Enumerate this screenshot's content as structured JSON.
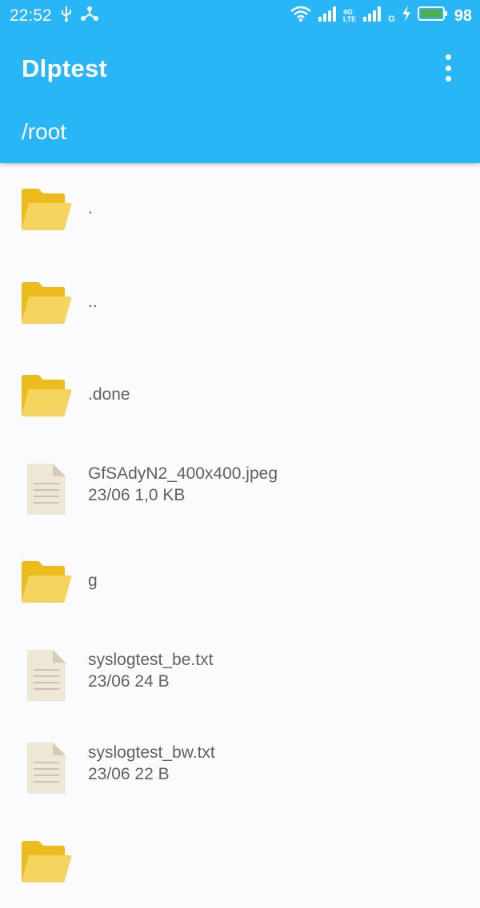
{
  "status_bar": {
    "time": "22:52",
    "network_label": "4G",
    "network_sub": "LTE",
    "g_label": "G",
    "battery": "98",
    "battery_color": "#4caf50"
  },
  "app_bar": {
    "title": "Dlptest",
    "menu_icon": "more-vert-icon"
  },
  "path": "/root",
  "colors": {
    "primary": "#29b6f6",
    "folder": "#f0c419",
    "file": "#efe9d8",
    "text": "#616161"
  },
  "items": [
    {
      "type": "folder",
      "name": ".",
      "meta": ""
    },
    {
      "type": "folder",
      "name": "..",
      "meta": ""
    },
    {
      "type": "folder",
      "name": ".done",
      "meta": ""
    },
    {
      "type": "file",
      "name": "GfSAdyN2_400x400.jpeg",
      "meta": "23/06 1,0 KB"
    },
    {
      "type": "folder",
      "name": "g",
      "meta": ""
    },
    {
      "type": "file",
      "name": "syslogtest_be.txt",
      "meta": "23/06 24 B"
    },
    {
      "type": "file",
      "name": "syslogtest_bw.txt",
      "meta": "23/06 22 B"
    },
    {
      "type": "folder",
      "name": "",
      "meta": ""
    }
  ]
}
